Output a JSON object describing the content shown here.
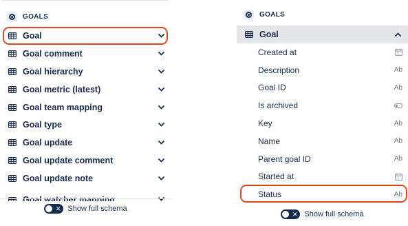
{
  "left": {
    "section_title": "GOALS",
    "items": [
      {
        "label": "Goal",
        "highlighted": true
      },
      {
        "label": "Goal comment"
      },
      {
        "label": "Goal hierarchy"
      },
      {
        "label": "Goal metric (latest)"
      },
      {
        "label": "Goal team mapping"
      },
      {
        "label": "Goal type"
      },
      {
        "label": "Goal update"
      },
      {
        "label": "Goal update comment"
      },
      {
        "label": "Goal update note"
      },
      {
        "label": "Goal watcher mapping"
      }
    ],
    "footer_label": "Show full schema",
    "toggle_state": "off"
  },
  "right": {
    "section_title": "GOALS",
    "expanded_item": "Goal",
    "fields": [
      {
        "name": "Created at",
        "type_icon": "calendar-icon"
      },
      {
        "name": "Description",
        "type": "Ab"
      },
      {
        "name": "Goal ID",
        "type": "Ab"
      },
      {
        "name": "Is archived",
        "type_icon": "toggle-icon"
      },
      {
        "name": "Key",
        "type": "Ab"
      },
      {
        "name": "Name",
        "type": "Ab"
      },
      {
        "name": "Parent goal ID",
        "type": "Ab"
      },
      {
        "name": "Started at",
        "type_icon": "calendar-icon"
      },
      {
        "name": "Status",
        "type": "Ab",
        "highlighted": true
      }
    ],
    "footer_label": "Show full schema",
    "toggle_state": "off"
  },
  "colors": {
    "text": "#172b4d",
    "muted": "#6b778c",
    "highlight": "#e2461f",
    "selected_bg": "#e4e6ea"
  }
}
